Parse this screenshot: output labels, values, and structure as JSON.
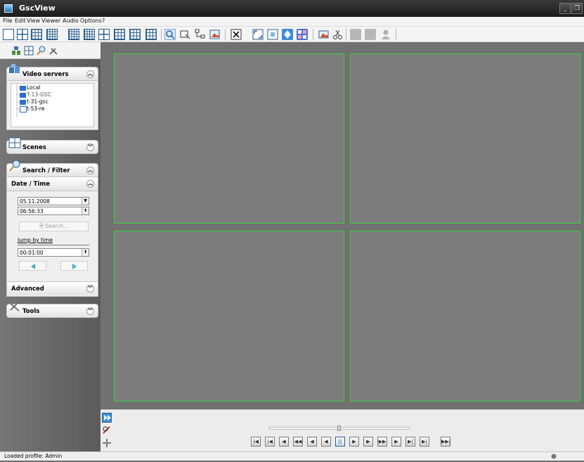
{
  "window": {
    "title": "GscView"
  },
  "menu": [
    "File",
    "Edit",
    "View",
    "Viewer",
    "Audio",
    "Options",
    "?"
  ],
  "toolbar_icons": [
    "layout-1x1-icon",
    "layout-2x2-icon",
    "layout-3x3-icon",
    "layout-4x4-icon",
    "layout-5x5-icon",
    "layout-1plus5-icon",
    "layout-1plus7-icon",
    "layout-1plus12-icon",
    "layout-border-icon",
    "zoom-icon",
    "snapshot-icon",
    "tree-icon",
    "bookmark-icon",
    "close-viewer-icon",
    "fullscreen-icon",
    "window-icon",
    "sync-icon",
    "grid-icon",
    "export-icon",
    "scissors-icon",
    "disk-icon",
    "archive-icon",
    "user-icon"
  ],
  "sidebar": {
    "video_servers": {
      "title": "Video servers",
      "items": [
        "Local",
        "T-13-GSC",
        "t-31-gsc",
        "t-53-re"
      ]
    },
    "scenes": {
      "title": "Scenes"
    },
    "search_filter": {
      "title": "Search / Filter",
      "date_time": {
        "title": "Date / Time",
        "date": "05.11.2008",
        "time": "06:56:33",
        "search_button": "Search...",
        "jump_label": "Jump by time",
        "jump_value": "00:01:00"
      },
      "advanced": {
        "title": "Advanced"
      }
    },
    "tools": {
      "title": "Tools"
    }
  },
  "status": {
    "text": "Loaded profile: Admin"
  },
  "colors": {
    "tile_border": "#39d13b",
    "accent": "#2b5f8f"
  }
}
